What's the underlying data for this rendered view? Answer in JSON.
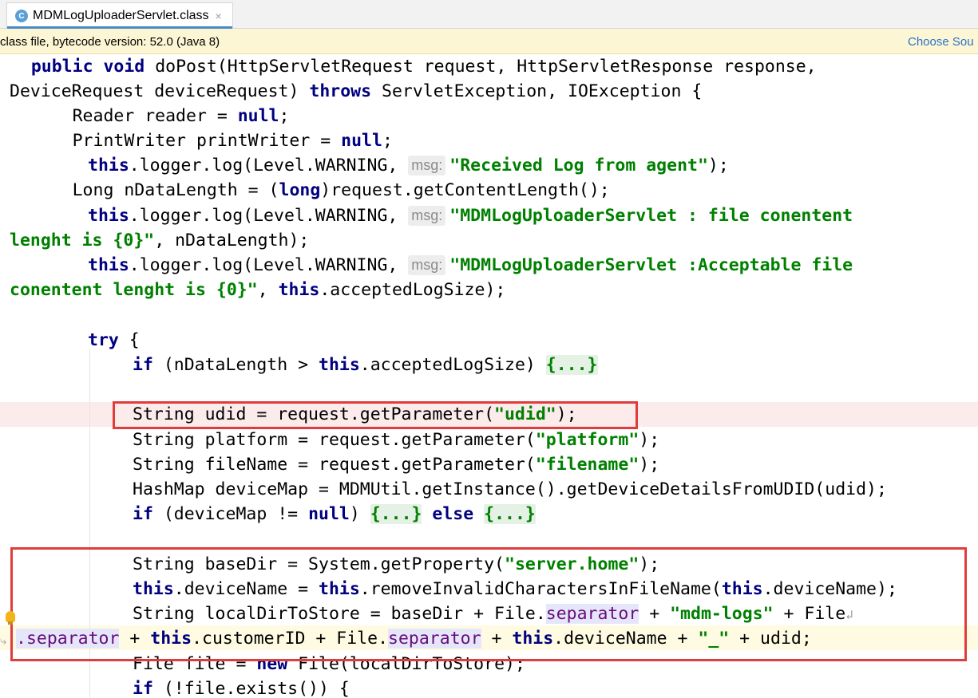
{
  "tab": {
    "title": "MDMLogUploaderServlet.class",
    "icon_letter": "C",
    "close_glyph": "×"
  },
  "infobar": {
    "text": "class file, bytecode version: 52.0 (Java 8)",
    "link": "Choose Sou"
  },
  "code": {
    "l1": {
      "p1": "   ",
      "kw1": "public",
      "sp1": " ",
      "kw2": "void",
      "rest": " doPost(HttpServletRequest request, HttpServletResponse response,"
    },
    "l2": {
      "a": "DeviceRequest deviceRequest) ",
      "kw": "throws",
      "b": " ServletException, IOException {"
    },
    "l3": {
      "a": "       Reader reader = ",
      "kw": "null",
      "b": ";"
    },
    "l4": {
      "a": "       PrintWriter printWriter = ",
      "kw": "null",
      "b": ";"
    },
    "l5": {
      "kw": "this",
      "a": ".logger.log(Level.WARNING, ",
      "hint": "msg:",
      "str": "\"Received Log from agent\"",
      "b": ");"
    },
    "l6": {
      "a": "       Long nDataLength = (",
      "kw": "long",
      "b": ")request.getContentLength();"
    },
    "l7": {
      "kw": "this",
      "a": ".logger.log(Level.WARNING, ",
      "hint": "msg:",
      "str": "\"MDMLogUploaderServlet : file conentent"
    },
    "l8": {
      "str": "lenght is {0}\"",
      "a": ", nDataLength);"
    },
    "l9": {
      "kw": "this",
      "a": ".logger.log(Level.WARNING, ",
      "hint": "msg:",
      "str": "\"MDMLogUploaderServlet :Acceptable file"
    },
    "l10": {
      "str": "conentent lenght is {0}\"",
      "a": ", ",
      "kw": "this",
      "b": ".acceptedLogSize);"
    },
    "l11": {
      "kw": "try",
      "a": " {"
    },
    "l12": {
      "kw1": "if",
      "a": " (nDataLength > ",
      "kw2": "this",
      "b": ".acceptedLogSize) ",
      "fold": "{...}"
    },
    "l13": {
      "a": "String udid = request.getParameter(",
      "str": "\"udid\"",
      "b": ");"
    },
    "l14": {
      "a": "String platform = request.getParameter(",
      "str": "\"platform\"",
      "b": ");"
    },
    "l15": {
      "a": "String fileName = request.getParameter(",
      "str": "\"filename\"",
      "b": ");"
    },
    "l16": {
      "a": "HashMap deviceMap = MDMUtil.getInstance().getDeviceDetailsFromUDID(udid);"
    },
    "l17": {
      "kw1": "if",
      "a": " (deviceMap != ",
      "kw2": "null",
      "b": ") ",
      "fold1": "{...}",
      "sp": " ",
      "kw3": "else",
      "sp2": " ",
      "fold2": "{...}"
    },
    "l18": {
      "a": "String baseDir = System.getProperty(",
      "str": "\"server.home\"",
      "b": ");"
    },
    "l19": {
      "kw1": "this",
      "a": ".deviceName = ",
      "kw2": "this",
      "b": ".removeInvalidCharactersInFileName(",
      "kw3": "this",
      "c": ".deviceName);"
    },
    "l20": {
      "a": "String localDirToStore = baseDir + File.",
      "sep": "separator",
      "b": " + ",
      "str": "\"mdm-logs\"",
      "c": " + File",
      "soft": "↲"
    },
    "l21": {
      "sep1": ".separator",
      "a": " + ",
      "kw1": "this",
      "b": ".customerID + File.",
      "sep2": "separator",
      "c": " + ",
      "kw2": "this",
      "d": ".deviceName + ",
      "str": "\"_\"",
      "e": " + udid;"
    },
    "l22": {
      "a": "File file = ",
      "kw": "new",
      "b": " File(localDirToStore);"
    },
    "l23": {
      "kw": "if",
      "a": " (!file.exists()) {"
    }
  }
}
